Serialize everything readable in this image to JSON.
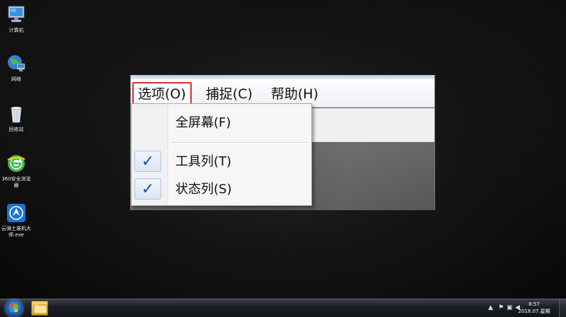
{
  "desktop": {
    "icons": [
      {
        "label": "计算机",
        "icon": "computer-icon"
      },
      {
        "label": "网络",
        "icon": "network-icon"
      },
      {
        "label": "回收站",
        "icon": "recycle-bin-icon"
      },
      {
        "label": "360安全浏览器",
        "icon": "browser-360-icon"
      },
      {
        "label": "云骑士装机大师.exe",
        "icon": "yunqishi-installer-icon"
      }
    ]
  },
  "app": {
    "menu": {
      "options": "选项(O)",
      "capture": "捕捉(C)",
      "help": "帮助(H)"
    },
    "dropdown": {
      "fullscreen": "全屏幕(F)",
      "toolbar": "工具列(T)",
      "statusbar": "状态列(S)",
      "check_mark": "✓"
    }
  },
  "taskbar": {
    "clock_time": "8:57",
    "clock_date": "2018.07.星期一"
  },
  "colors": {
    "highlight_border": "#d9302c",
    "check": "#1a4fb6"
  }
}
